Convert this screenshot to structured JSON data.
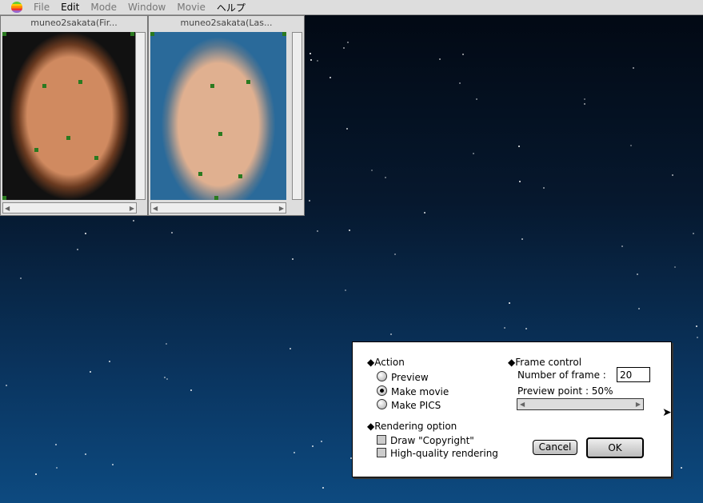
{
  "menubar": {
    "items": [
      "File",
      "Edit",
      "Mode",
      "Window",
      "Movie",
      "ヘルプ"
    ]
  },
  "windows": [
    {
      "title": "muneo2sakata(Fir..."
    },
    {
      "title": "muneo2sakata(Las..."
    }
  ],
  "dialog": {
    "action_heading": "◆Action",
    "actions": [
      {
        "label": "Preview",
        "selected": false
      },
      {
        "label": "Make movie",
        "selected": true
      },
      {
        "label": "Make PICS",
        "selected": false
      }
    ],
    "frame_heading": "◆Frame control",
    "frame_label": "Number of frame  :",
    "frame_value": "20",
    "preview_label": "Preview point : 50%",
    "preview_value": 50,
    "render_heading": "◆Rendering option",
    "options": [
      {
        "label": "Draw \"Copyright\"",
        "checked": false
      },
      {
        "label": "High-quality rendering",
        "checked": false
      }
    ],
    "cancel": "Cancel",
    "ok": "OK"
  }
}
